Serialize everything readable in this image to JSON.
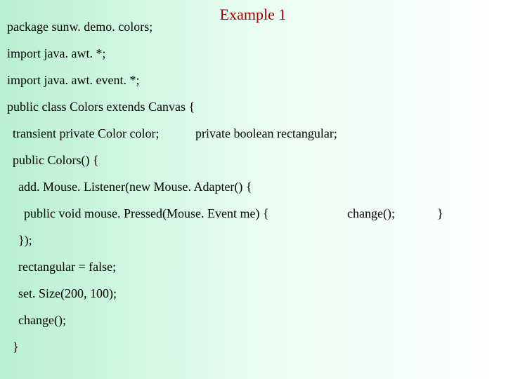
{
  "title": "Example 1",
  "lines": {
    "l1": "package sunw. demo. colors;",
    "l2": "import java. awt. *;",
    "l3": "import java. awt. event. *;",
    "l4": "public class Colors extends Canvas {",
    "l5a": "transient private Color color;",
    "l5b": "private boolean rectangular;",
    "l6": "public Colors() {",
    "l7": "add. Mouse. Listener(new Mouse. Adapter() {",
    "l8a": "public void mouse. Pressed(Mouse. Event me) {",
    "l8b": "change();",
    "l8c": "}",
    "l9": "});",
    "l10": "rectangular = false;",
    "l11": "set. Size(200, 100);",
    "l12": "change();",
    "l13": "}"
  }
}
